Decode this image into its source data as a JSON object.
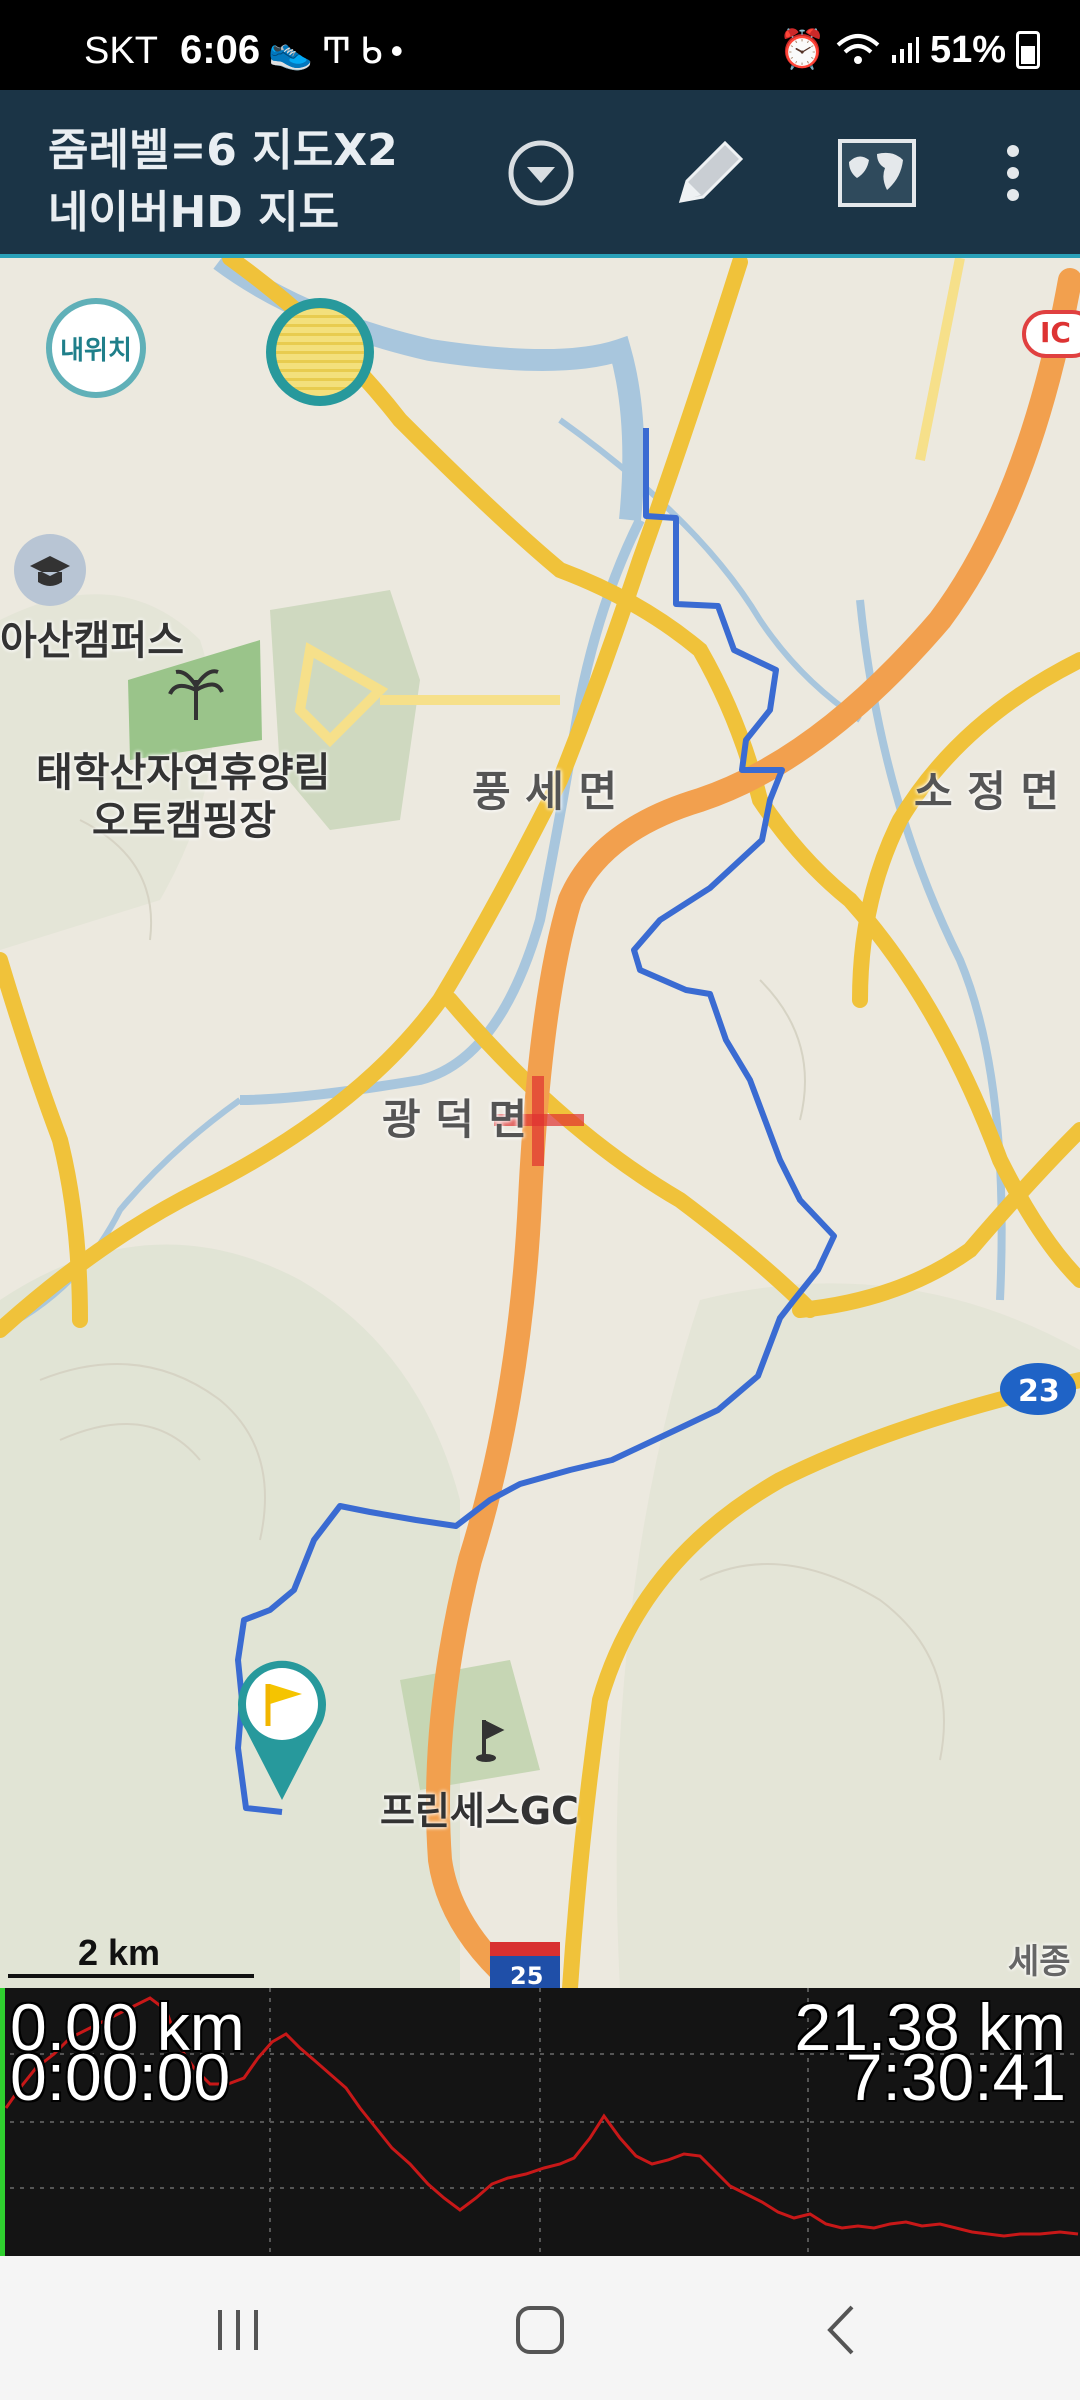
{
  "status_bar": {
    "carrier": "SKT",
    "time": "6:06",
    "left_icons": [
      "sneaker-icon",
      "t-icon",
      "b-icon",
      "dot-icon"
    ],
    "right_icons": [
      "alarm-icon",
      "wifi-icon",
      "signal-icon"
    ],
    "battery": "51%"
  },
  "toolbar": {
    "title_line1": "줌레벨=6 지도X2",
    "title_line2": "네이버HD 지도",
    "buttons": [
      "dropdown-icon",
      "pencil-icon",
      "map-icon",
      "more-vert-icon"
    ]
  },
  "map": {
    "my_location_label": "내위치",
    "labels": {
      "campus": "아산캠퍼스",
      "forest_line1": "태학산자연휴양림",
      "forest_line2": "오토캠핑장",
      "pungse": "풍 세 면",
      "sojeong": "소 정 면",
      "gwangdeok": "광 덕 면",
      "golf": "프린세스GC",
      "sejong": "세종",
      "ic": "IC",
      "route23": "23",
      "route25": "25"
    },
    "scale_label": "2 km"
  },
  "elevation": {
    "start_distance": "0.00 km",
    "start_time": "0:00:00",
    "total_distance": "21.38 km",
    "total_time": "7:30:41"
  },
  "nav_bar": [
    "recents-icon",
    "home-icon",
    "back-icon"
  ]
}
